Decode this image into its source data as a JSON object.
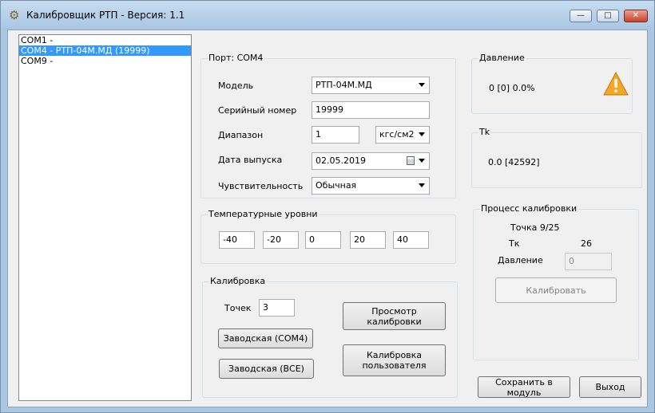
{
  "window": {
    "title": "Калибровщик РТП  -  Версия: 1.1",
    "minimize": "—",
    "maximize": "□",
    "close": "✕"
  },
  "ports": [
    {
      "label": "COM1 -",
      "selected": false
    },
    {
      "label": "COM4 - РТП-04М.МД (19999)",
      "selected": true
    },
    {
      "label": "COM9 -",
      "selected": false
    }
  ],
  "port_group": {
    "title": "Порт: COM4",
    "model_label": "Модель",
    "model_value": "РТП-04М.МД",
    "serial_label": "Серийный номер",
    "serial_value": "19999",
    "range_label": "Диапазон",
    "range_value": "1",
    "unit_value": "кгс/см2",
    "date_label": "Дата выпуска",
    "date_value": "02.05.2019",
    "sensitivity_label": "Чувствительность",
    "sensitivity_value": "Обычная"
  },
  "temp_group": {
    "title": "Температурные уровни",
    "levels": [
      "-40",
      "-20",
      "0",
      "20",
      "40"
    ]
  },
  "calib_group": {
    "title": "Калибровка",
    "points_label": "Точек",
    "points_value": "3",
    "factory_com4": "Заводская (COM4)",
    "factory_all": "Заводская (ВСЕ)",
    "view_calibration": "Просмотр калибровки",
    "user_calibration": "Калибровка пользователя"
  },
  "pressure_group": {
    "title": "Давление",
    "value": "0 [0] 0.0%",
    "status_icon": "warning-icon"
  },
  "tk_group": {
    "title": "Tk",
    "value": "0.0 [42592]"
  },
  "process_group": {
    "title": "Процесс калибровки",
    "point_text": "Точка 9/25",
    "tk_label": "Тк",
    "tk_value": "26",
    "pressure_label": "Давление",
    "pressure_value": "0",
    "calibrate_button": "Калибровать"
  },
  "footer": {
    "save_button": "Сохранить в модуль",
    "exit_button": "Выход"
  },
  "colors": {
    "selection": "#3399ff",
    "warning": "#f5a623"
  }
}
